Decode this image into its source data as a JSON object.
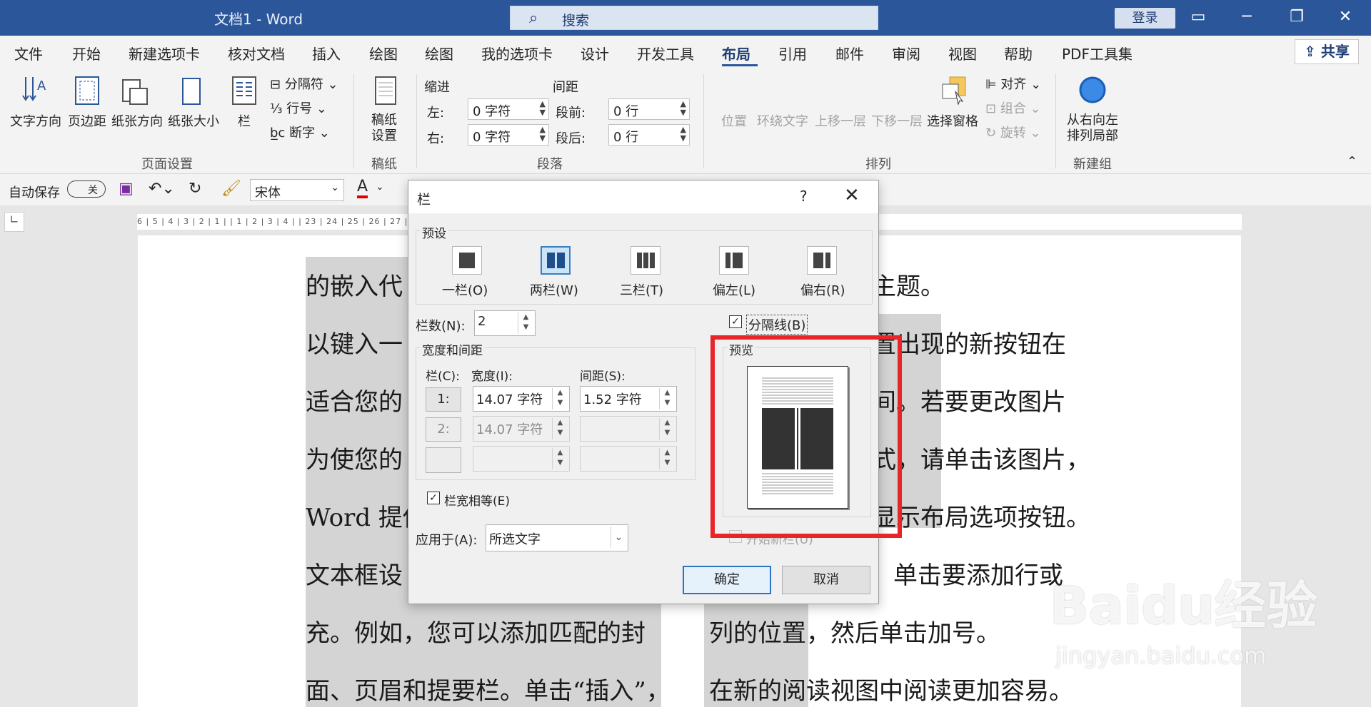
{
  "titlebar": {
    "title": "文档1 - Word",
    "search_placeholder": "搜索",
    "login": "登录"
  },
  "menu": {
    "items": [
      "文件",
      "开始",
      "新建选项卡",
      "核对文档",
      "插入",
      "绘图",
      "绘图",
      "我的选项卡",
      "设计",
      "开发工具",
      "布局",
      "引用",
      "邮件",
      "审阅",
      "视图",
      "帮助",
      "PDF工具集"
    ],
    "active": "布局",
    "share": "共享"
  },
  "ribbon": {
    "page_setup": {
      "text_direction": "文字方向",
      "margins": "页边距",
      "orientation": "纸张方向",
      "size": "纸张大小",
      "columns": "栏",
      "breaks": "分隔符",
      "line_numbers": "行号",
      "hyphenation": "断字",
      "group": "页面设置"
    },
    "draft": {
      "label_1": "稿纸",
      "label_2": "设置",
      "group": "稿纸"
    },
    "paragraph": {
      "indent": "缩进",
      "spacing": "间距",
      "left": "左:",
      "right": "右:",
      "left_val": "0 字符",
      "right_val": "0 字符",
      "before": "段前:",
      "after": "段后:",
      "before_val": "0 行",
      "after_val": "0 行",
      "group": "段落"
    },
    "arrange": {
      "position": "位置",
      "wrap": "环绕文字",
      "forward": "上移一层",
      "backward": "下移一层",
      "selection_pane": "选择窗格",
      "align": "对齐",
      "group_obj": "组合",
      "rotate": "旋转",
      "group": "排列"
    },
    "newgroup": {
      "label_1": "从右向左",
      "label_2": "排列局部",
      "group": "新建组"
    }
  },
  "qat": {
    "autosave": "自动保存",
    "autosave_state": "关",
    "font": "宋体"
  },
  "ruler": {
    "ticks": "6 | 5 | 4 | 3 | 2 | 1 |    | 1 | 2 | 3 | 4 |                                                                                        | 23 | 24 | 25 | 26 | 27 | 28 | 29 | 30 | 31 | 32 | 33 | 34 | 35 | 36"
  },
  "document": {
    "left": [
      "的嵌入代",
      "以键入一",
      "适合您的",
      "为使您的",
      "Word 提供",
      "文本框设",
      "充。例如，您可以添加匹配的封",
      "面、页眉和提要栏。单击“插入”，"
    ],
    "right": [
      "主题。",
      "置出现的新按钮在",
      "间。若要更改图片",
      "式，请单击该图片，",
      "显示布局选项按钮。",
      "单击要添加行或",
      "列的位置，然后单击加号。",
      "在新的阅读视图中阅读更加容易。"
    ]
  },
  "dialog": {
    "title": "栏",
    "help": "?",
    "presets_label": "预设",
    "presets": [
      "一栏(O)",
      "两栏(W)",
      "三栏(T)",
      "偏左(L)",
      "偏右(R)"
    ],
    "count_label": "栏数(N):",
    "count": "2",
    "line_between": "分隔线(B)",
    "width_spacing_label": "宽度和间距",
    "col_header": "栏(C):",
    "width_header": "宽度(I):",
    "spacing_header": "间距(S):",
    "rows": [
      {
        "col": "1:",
        "width": "14.07 字符",
        "spacing": "1.52 字符"
      },
      {
        "col": "2:",
        "width": "14.07 字符",
        "spacing": ""
      }
    ],
    "equal_width": "栏宽相等(E)",
    "apply_label": "应用于(A):",
    "apply_value": "所选文字",
    "preview_label": "预览",
    "new_column": "开始新栏(U)",
    "ok": "确定",
    "cancel": "取消"
  },
  "watermark": {
    "brand": "Baidu经验",
    "url": "jingyan.baidu.com"
  }
}
